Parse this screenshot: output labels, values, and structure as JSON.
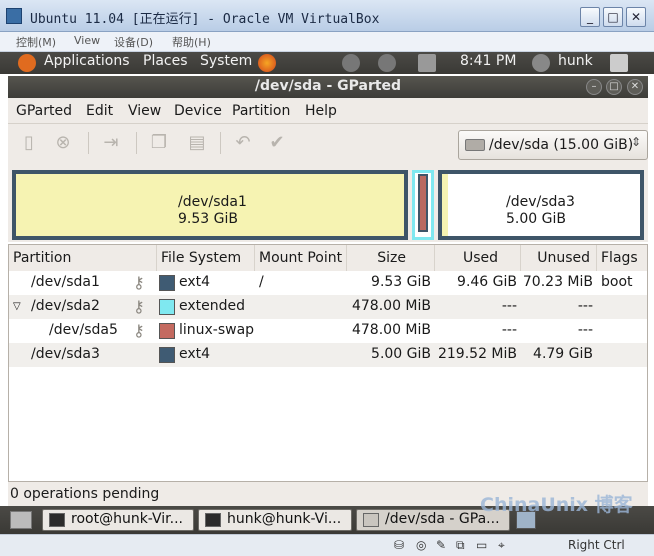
{
  "vbox": {
    "title": "Ubuntu 11.04 [正在运行] - Oracle VM VirtualBox",
    "menu": [
      "控制(M)",
      "View",
      "设备(D)",
      "帮助(H)"
    ],
    "controls": [
      "_",
      "□",
      "✕"
    ]
  },
  "panel": {
    "applications": "Applications",
    "places": "Places",
    "system": "System",
    "time": "8:41 PM",
    "user": "hunk"
  },
  "gparted": {
    "title": "/dev/sda - GParted",
    "menu": [
      "GParted",
      "Edit",
      "View",
      "Device",
      "Partition",
      "Help"
    ],
    "device_selector": "/dev/sda  (15.00 GiB)"
  },
  "map": {
    "sda1_name": "/dev/sda1",
    "sda1_size": "9.53 GiB",
    "sda3_name": "/dev/sda3",
    "sda3_size": "5.00 GiB"
  },
  "table": {
    "headers": [
      "Partition",
      "File System",
      "Mount Point",
      "Size",
      "Used",
      "Unused",
      "Flags"
    ],
    "rows": [
      {
        "partition": "/dev/sda1",
        "fs": "ext4",
        "mount": "/",
        "size": "9.53 GiB",
        "used": "9.46 GiB",
        "unused": "70.23 MiB",
        "flags": "boot",
        "color": "#3f5b73"
      },
      {
        "partition": "/dev/sda2",
        "fs": "extended",
        "mount": "",
        "size": "478.00 MiB",
        "used": "---",
        "unused": "---",
        "flags": "",
        "color": "#7fe8f0"
      },
      {
        "partition": "/dev/sda5",
        "fs": "linux-swap",
        "mount": "",
        "size": "478.00 MiB",
        "used": "---",
        "unused": "---",
        "flags": "",
        "color": "#c46a60"
      },
      {
        "partition": "/dev/sda3",
        "fs": "ext4",
        "mount": "",
        "size": "5.00 GiB",
        "used": "219.52 MiB",
        "unused": "4.79 GiB",
        "flags": "",
        "color": "#3f5b73"
      }
    ]
  },
  "status": "0 operations pending",
  "taskbar": [
    "root@hunk-Vir...",
    "hunk@hunk-Vi...",
    "/dev/sda - GPa..."
  ],
  "watermark": "ChinaUnix 博客",
  "vbox_status": "Right Ctrl"
}
